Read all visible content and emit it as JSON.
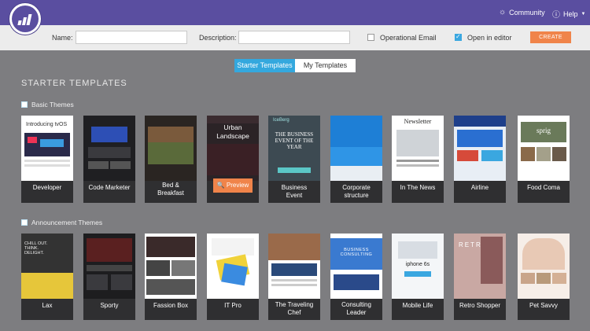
{
  "header": {
    "community_label": "Community",
    "help_label": "Help",
    "community_icon": "chat-icon",
    "help_icon": "help-icon"
  },
  "form": {
    "name_label": "Name:",
    "name_value": "",
    "description_label": "Description:",
    "description_value": "",
    "operational_email_label": "Operational Email",
    "operational_email_checked": false,
    "open_in_editor_label": "Open in editor",
    "open_in_editor_checked": true,
    "create_label": "CREATE"
  },
  "tabs": [
    {
      "label": "Starter Templates",
      "active": true
    },
    {
      "label": "My Templates",
      "active": false
    }
  ],
  "section_title": "STARTER TEMPLATES",
  "groups": [
    {
      "title": "Basic Themes",
      "templates": [
        {
          "label": "Developer",
          "thumb_text": "Introducing tvOS"
        },
        {
          "label": "Code Marketer",
          "thumb_text": ""
        },
        {
          "label": "Bed &\nBreakfast",
          "thumb_text": ""
        },
        {
          "label": "Business\nEvent",
          "thumb_text": "THE BUSINESS EVENT OF THE YEAR",
          "brand": "IceBerg"
        },
        {
          "label": "Corporate\nstructure",
          "thumb_text": ""
        },
        {
          "label": "In The News",
          "thumb_text": "Newsletter"
        },
        {
          "label": "Airline",
          "thumb_text": ""
        },
        {
          "label": "Food Coma",
          "thumb_text": "sprig"
        }
      ],
      "hover_template": {
        "label": "Urban\nLandscape",
        "preview_label": "Preview"
      }
    },
    {
      "title": "Announcement Themes",
      "templates": [
        {
          "label": "Lax",
          "thumb_text": "CHILL OUT. THINK. DELIGHT."
        },
        {
          "label": "Sporty",
          "thumb_text": ""
        },
        {
          "label": "Fassion Box",
          "thumb_text": ""
        },
        {
          "label": "IT Pro",
          "thumb_text": ""
        },
        {
          "label": "The Traveling\nChef",
          "thumb_text": ""
        },
        {
          "label": "Consulting\nLeader",
          "thumb_text": "BUSINESS CONSULTING"
        },
        {
          "label": "Mobile Life",
          "thumb_text": "iphone 6s"
        },
        {
          "label": "Retro Shopper",
          "thumb_text": "RETRO"
        },
        {
          "label": "Pet Savvy",
          "thumb_text": ""
        }
      ]
    }
  ],
  "colors": {
    "topbar": "#5a4ea0",
    "accent": "#f0844a",
    "tab_active": "#34a8de",
    "background": "#7d7d80"
  }
}
